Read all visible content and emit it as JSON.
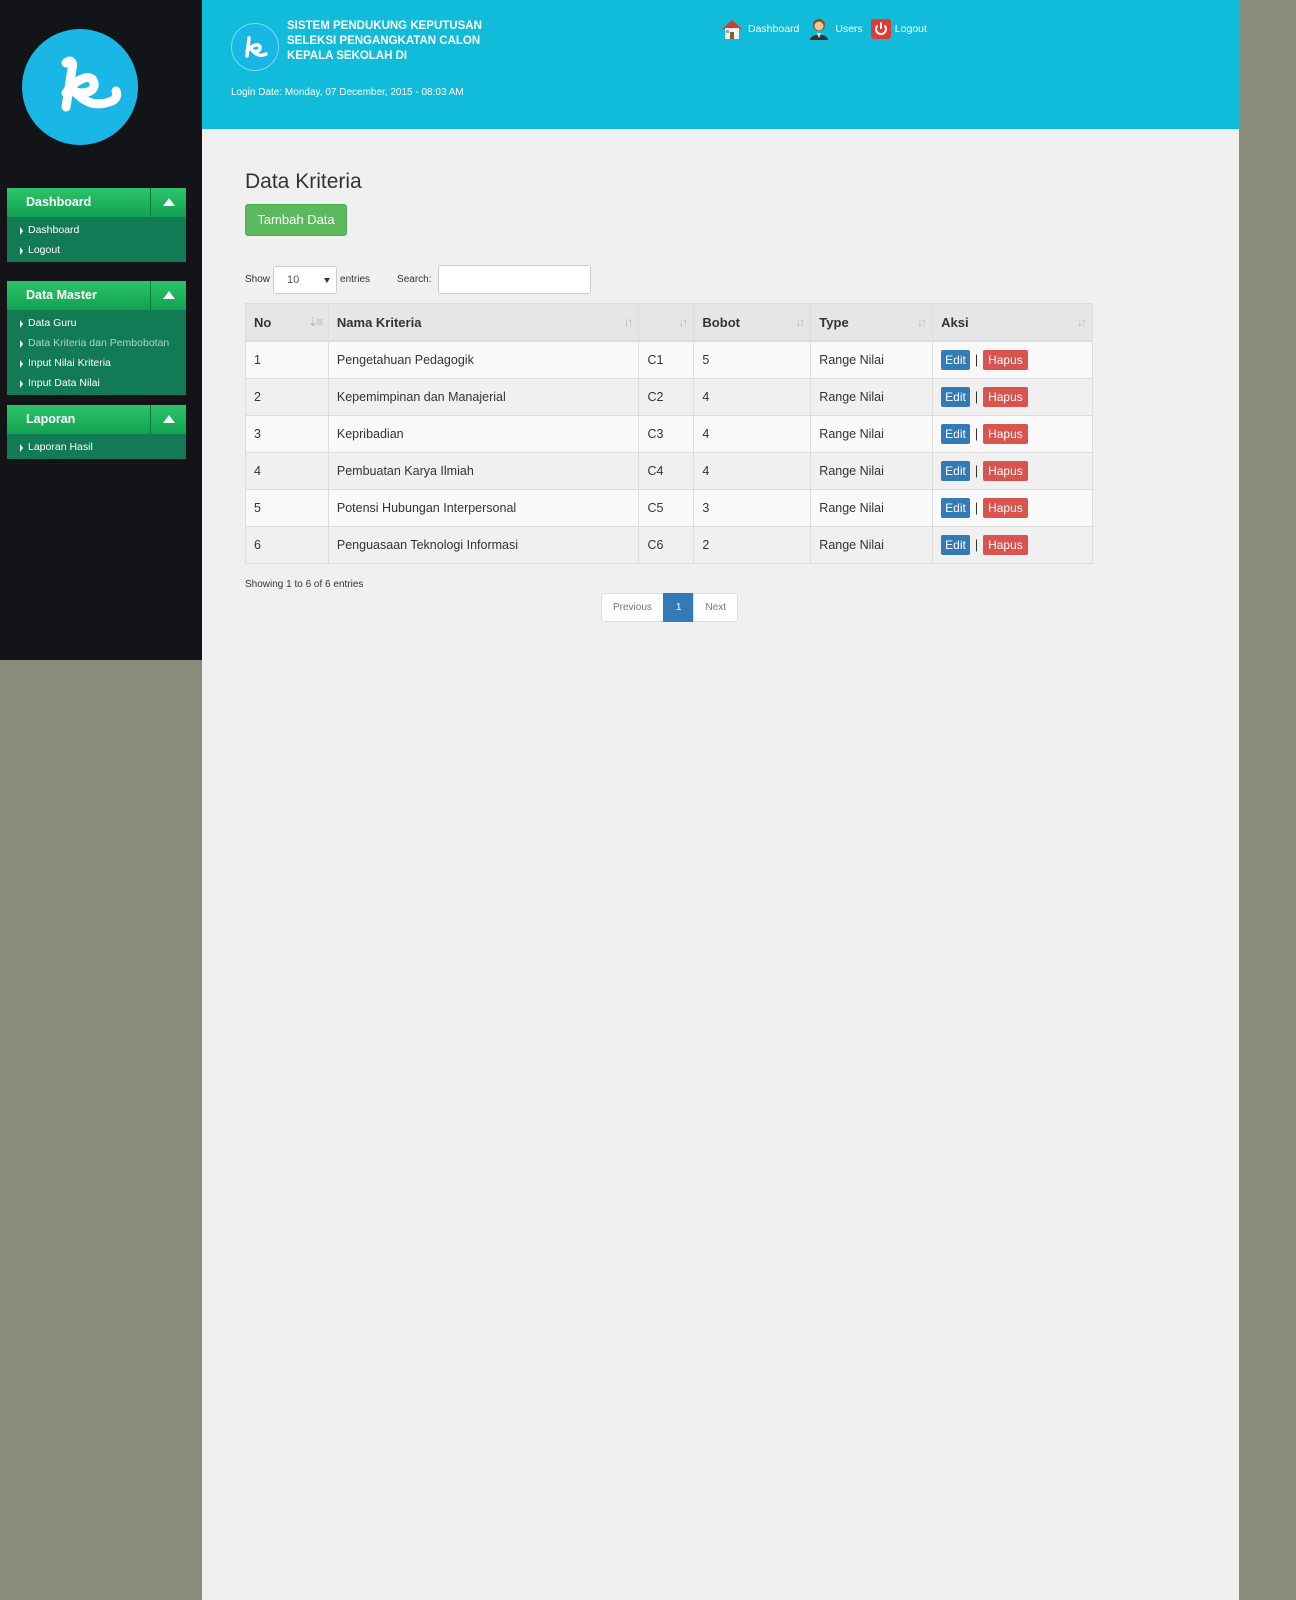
{
  "app": {
    "title": "SISTEM PENDUKUNG KEPUTUSAN SELEKSI PENGANGKATAN CALON KEPALA SEKOLAH DI",
    "login_date": "Login Date: Monday, 07 December, 2015 - 08:03 AM"
  },
  "top_nav": {
    "dashboard": "Dashboard",
    "users": "Users",
    "logout": "Logout"
  },
  "sidebar": {
    "sections": [
      {
        "title": "Dashboard",
        "items": [
          "Dashboard",
          "Logout"
        ]
      },
      {
        "title": "Data Master",
        "items": [
          "Data Guru",
          "Data Kriteria dan Pembobotan",
          "Input Nilai Kriteria",
          "Input Data Nilai"
        ]
      },
      {
        "title": "Laporan",
        "items": [
          "Laporan Hasil"
        ]
      }
    ]
  },
  "main": {
    "page_title": "Data Kriteria",
    "add_button": "Tambah Data",
    "show_label": "Show",
    "length_value": "10",
    "entries_label": "entries",
    "search_label": "Search:",
    "columns": [
      "No",
      "Nama Kriteria",
      "",
      "Bobot",
      "Type",
      "Aksi"
    ],
    "rows": [
      [
        "1",
        "Pengetahuan Pedagogik",
        "C1",
        "5",
        "Range Nilai"
      ],
      [
        "2",
        "Kepemimpinan dan Manajerial",
        "C2",
        "4",
        "Range Nilai"
      ],
      [
        "3",
        "Kepribadian",
        "C3",
        "4",
        "Range Nilai"
      ],
      [
        "4",
        "Pembuatan Karya Ilmiah",
        "C4",
        "4",
        "Range Nilai"
      ],
      [
        "5",
        "Potensi Hubungan Interpersonal",
        "C5",
        "3",
        "Range Nilai"
      ],
      [
        "6",
        "Penguasaan Teknologi Informasi",
        "C6",
        "2",
        "Range Nilai"
      ]
    ],
    "edit_label": "Edit",
    "delete_label": "Hapus",
    "separator": "|",
    "info": "Showing 1 to 6 of 6 entries",
    "pagination": {
      "previous": "Previous",
      "current": "1",
      "next": "Next"
    }
  },
  "colors": {
    "header": "#10bcd9",
    "sidebar": "#131417",
    "menu_head": "#1fb25e",
    "menu_body": "#137a56",
    "add_button": "#5cb85c",
    "edit_button": "#337ab7",
    "delete_button": "#d9534f"
  },
  "icons": [
    "home-icon",
    "users-icon",
    "power-icon",
    "logo-k-icon"
  ]
}
